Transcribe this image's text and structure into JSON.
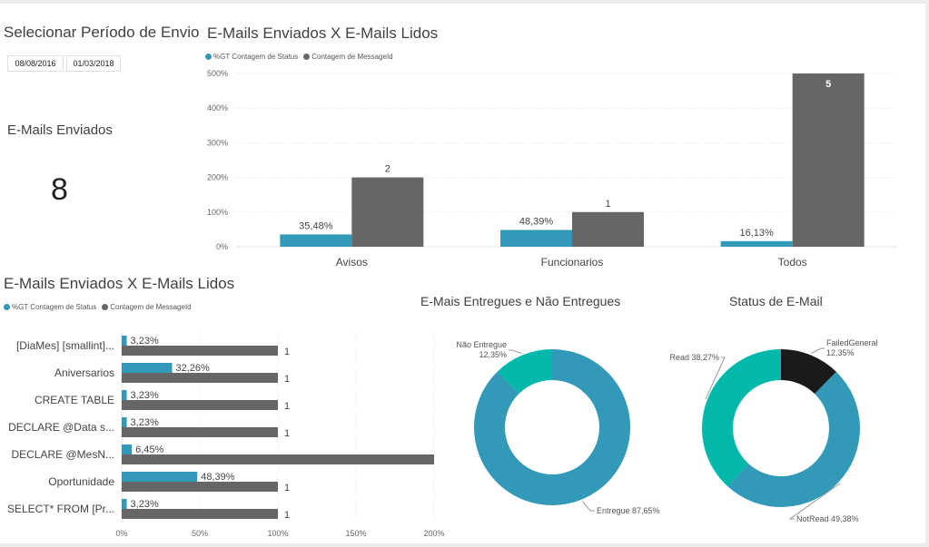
{
  "period_filter": {
    "title": "Selecionar Período de Envio",
    "start_date": "08/08/2016",
    "end_date": "01/03/2018"
  },
  "kpi": {
    "title": "E-Mails Enviados",
    "value": "8"
  },
  "colors": {
    "teal": "#3399b8",
    "dark_gray": "#666666",
    "black": "#1a1a1a",
    "green": "#01b8aa"
  },
  "chart_data": [
    {
      "type": "bar",
      "title": "E-Mails Enviados X E-Mails Lidos",
      "legend_position": "top-left",
      "categories": [
        "Avisos",
        "Funcionarios",
        "Todos"
      ],
      "series": [
        {
          "name": "%GT Contagem de Status",
          "values": [
            35.48,
            48.39,
            16.13
          ],
          "labels": [
            "35,48%",
            "48,39%",
            "16,13%"
          ],
          "color": "#3399b8"
        },
        {
          "name": "Contagem de MessageId",
          "values": [
            2,
            1,
            5
          ],
          "labels": [
            "2",
            "1",
            "5"
          ],
          "color": "#666666"
        }
      ],
      "y_ticks": [
        "0%",
        "100%",
        "200%",
        "300%",
        "400%",
        "500%"
      ],
      "ylim": [
        0,
        500
      ],
      "grid": true
    },
    {
      "type": "bar",
      "orientation": "horizontal",
      "title": "E-Mails Enviados X E-Mails Lidos",
      "legend_position": "top-left",
      "categories": [
        "[DiaMes] [smallint]...",
        "Aniversarios",
        "CREATE TABLE",
        "DECLARE @Data s...",
        "DECLARE @MesN...",
        "Oportunidade",
        "SELECT* FROM [Pr..."
      ],
      "series": [
        {
          "name": "%GT Contagem de Status",
          "values": [
            3.23,
            32.26,
            3.23,
            3.23,
            6.45,
            48.39,
            3.23
          ],
          "labels": [
            "3,23%",
            "32,26%",
            "3,23%",
            "3,23%",
            "6,45%",
            "48,39%",
            "3,23%"
          ],
          "color": "#3399b8"
        },
        {
          "name": "Contagem de MessageId",
          "values": [
            1,
            1,
            1,
            1,
            2,
            1,
            1
          ],
          "labels": [
            "1",
            "1",
            "1",
            "1",
            "",
            "1",
            "1"
          ],
          "color": "#666666"
        }
      ],
      "x_ticks": [
        "0%",
        "50%",
        "100%",
        "150%",
        "200%"
      ],
      "xlim": [
        0,
        200
      ],
      "grid": true
    },
    {
      "type": "pie",
      "donut": true,
      "title": "E-Mais Entregues e Não Entregues",
      "slices": [
        {
          "label": "Entregue",
          "value": 87.65,
          "display": "Entregue 87,65%",
          "color": "#3399b8"
        },
        {
          "label": "Não Entregue",
          "value": 12.35,
          "display_line1": "Não Entregue",
          "display_line2": "12,35%",
          "color": "#01b8aa"
        }
      ]
    },
    {
      "type": "pie",
      "donut": true,
      "title": "Status de E-Mail",
      "slices": [
        {
          "label": "FailedGeneral",
          "value": 12.35,
          "display_line1": "FailedGeneral",
          "display_line2": "12,35%",
          "color": "#1a1a1a"
        },
        {
          "label": "NotRead",
          "value": 49.38,
          "display": "NotRead 49,38%",
          "color": "#3399b8"
        },
        {
          "label": "Read",
          "value": 38.27,
          "display": "Read 38,27%",
          "color": "#01b8aa"
        }
      ]
    }
  ]
}
